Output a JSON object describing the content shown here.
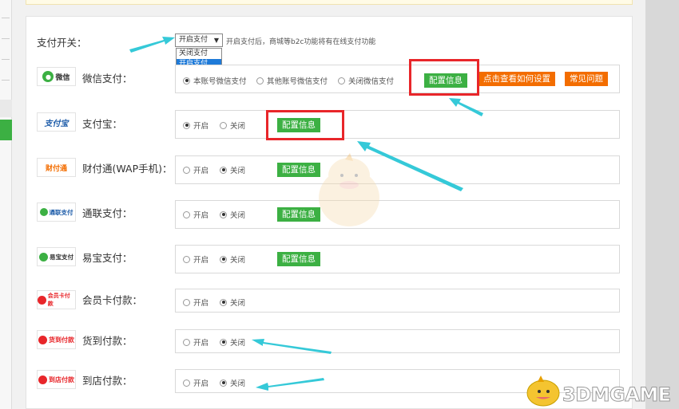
{
  "pay_switch": {
    "label": "支付开关：",
    "selected": "开启支付",
    "options": [
      "关闭支付",
      "开启支付"
    ],
    "hint": "开启支付后，商城等b2c功能将有在线支付功能"
  },
  "methods": [
    {
      "name": "微信支付：",
      "logo": "微信",
      "radios": [
        "本账号微信支付",
        "其他账号微信支付",
        "关闭微信支付"
      ],
      "buttons": [
        "配置信息",
        "点击查看如何设置",
        "常见问题"
      ]
    },
    {
      "name": "支付宝：",
      "logo": "支付宝",
      "radios": [
        "开启",
        "关闭"
      ],
      "button": "配置信息"
    },
    {
      "name": "财付通(WAP手机)：",
      "logo": "财付通",
      "radios": [
        "开启",
        "关闭"
      ],
      "button": "配置信息"
    },
    {
      "name": "通联支付：",
      "logo": "通联支付",
      "radios": [
        "开启",
        "关闭"
      ],
      "button": "配置信息"
    },
    {
      "name": "易宝支付：",
      "logo": "易宝支付",
      "radios": [
        "开启",
        "关闭"
      ],
      "button": "配置信息"
    },
    {
      "name": "会员卡付款：",
      "logo": "会员卡付款",
      "radios": [
        "开启",
        "关闭"
      ]
    },
    {
      "name": "货到付款：",
      "logo": "货到付款",
      "radios": [
        "开启",
        "关闭"
      ]
    },
    {
      "name": "到店付款：",
      "logo": "到店付款",
      "radios": [
        "开启",
        "关闭"
      ]
    }
  ],
  "watermark": "3DMGAME",
  "colors": {
    "green": "#3cb043",
    "orange": "#f36d00",
    "red_highlight": "#e8262a",
    "arrow": "#35c9d8",
    "select_blue": "#1e7ad8"
  }
}
